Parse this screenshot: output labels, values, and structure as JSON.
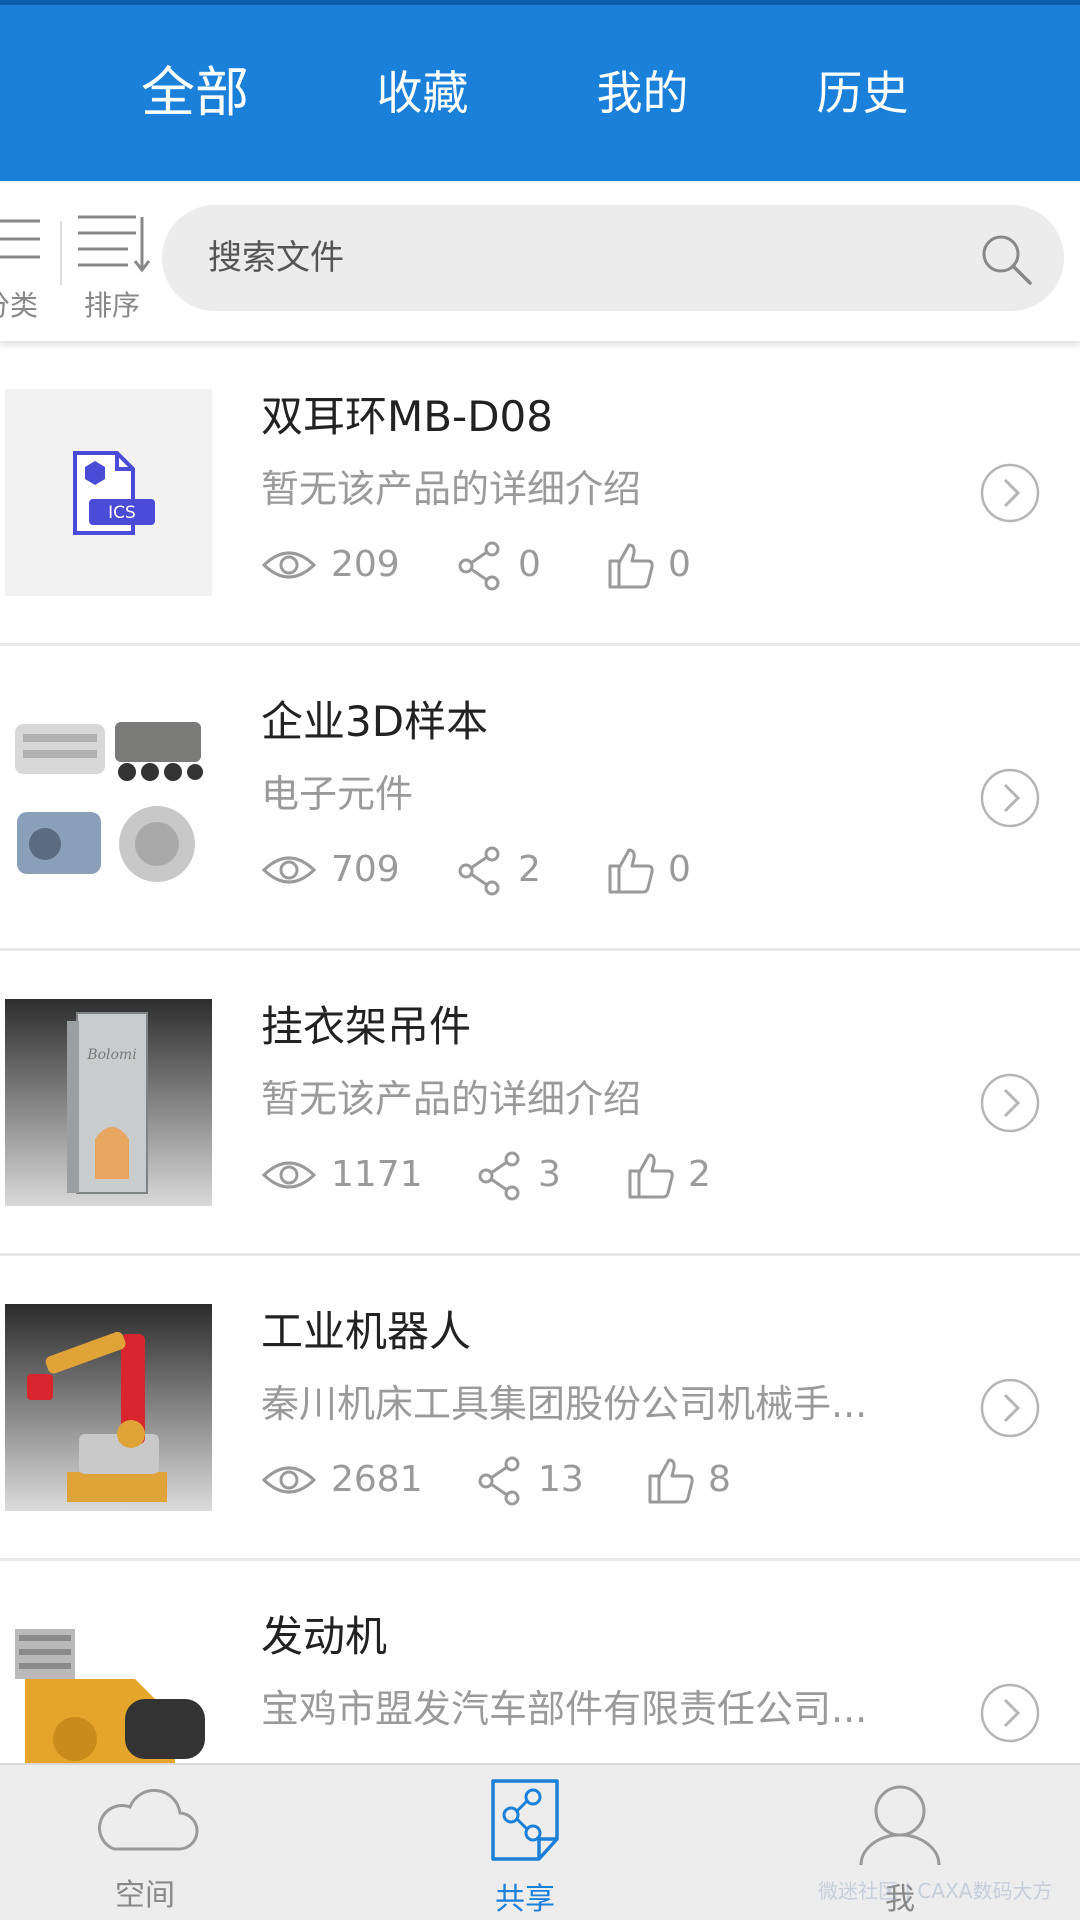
{
  "top_tabs": [
    {
      "label": "全部",
      "active": true
    },
    {
      "label": "收藏",
      "active": false
    },
    {
      "label": "我的",
      "active": false
    },
    {
      "label": "历史",
      "active": false
    }
  ],
  "toolbar": {
    "category_label": "分类",
    "sort_label": "排序"
  },
  "search": {
    "placeholder": "搜索文件"
  },
  "items": [
    {
      "title": "双耳环MB-D08",
      "description": "暂无该产品的详细介绍",
      "views": "209",
      "shares": "0",
      "likes": "0",
      "thumb_text": "ICS"
    },
    {
      "title": "企业3D样本",
      "description": "电子元件",
      "views": "709",
      "shares": "2",
      "likes": "0"
    },
    {
      "title": "挂衣架吊件",
      "description": "暂无该产品的详细介绍",
      "views": "1171",
      "shares": "3",
      "likes": "2",
      "thumb_text": "Bolomi"
    },
    {
      "title": "工业机器人",
      "description": "秦川机床工具集团股份公司机械手...",
      "views": "2681",
      "shares": "13",
      "likes": "8"
    },
    {
      "title": "发动机",
      "description": "宝鸡市盟发汽车部件有限责任公司..."
    }
  ],
  "bottom_nav": [
    {
      "label": "空间",
      "icon": "cloud-icon",
      "active": false
    },
    {
      "label": "共享",
      "icon": "share-doc-icon",
      "active": true
    },
    {
      "label": "我",
      "icon": "user-icon",
      "active": false
    }
  ],
  "watermark": "微迷社区 | CAXA数码大方",
  "colors": {
    "primary": "#1a80d9",
    "active_nav": "#1a80d9",
    "muted_text": "#9a9a9a"
  }
}
